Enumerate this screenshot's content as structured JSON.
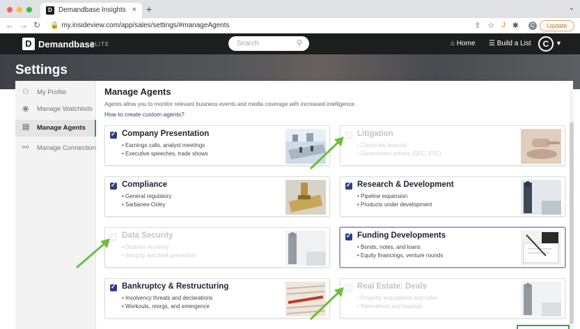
{
  "browser": {
    "tab_title": "Demandbase Insights",
    "tab_favicon": "D",
    "tab_close": "×",
    "new_tab": "+",
    "url": "my.insideview.com/app/sales/settings/#manageAgents",
    "update_label": "Update",
    "profile_initial": "C"
  },
  "header": {
    "logo_letter": "D",
    "brand": "Demandbase",
    "edition": "ELITE",
    "search_placeholder": "Search",
    "home_label": "Home",
    "build_list_label": "Build a List",
    "avatar_initial": "C"
  },
  "page": {
    "title": "Settings"
  },
  "sidebar": {
    "items": [
      {
        "label": "My Profile",
        "icon": "profile-icon"
      },
      {
        "label": "Manage Watchlists",
        "icon": "eye-icon"
      },
      {
        "label": "Manage Agents",
        "icon": "agents-icon",
        "active": true
      },
      {
        "label": "Manage Connections",
        "icon": "connections-icon"
      }
    ]
  },
  "main": {
    "title": "Manage Agents",
    "description": "Agents allow you to monitor relevant business events and media coverage with increased intelligence.",
    "help_link": "How to create custom agents?",
    "cards": [
      {
        "title": "Company Presentation",
        "bullets": [
          "• Earnings calls, analyst meetings",
          "• Executive speeches, trade shows"
        ],
        "checked": true,
        "image": "conference-room-image"
      },
      {
        "title": "Litigation",
        "bullets": [
          "• Corporate lawsuits",
          "• Government actions (SEC, FTC)"
        ],
        "checked": false,
        "image": "gavel-image"
      },
      {
        "title": "Compliance",
        "bullets": [
          "• General regulatory",
          "• Sarbanes-Oxley"
        ],
        "checked": true,
        "image": "compliance-stamp-image"
      },
      {
        "title": "Research & Development",
        "bullets": [
          "• Pipeline expansion",
          "• Products under development"
        ],
        "checked": true,
        "image": "business-person-image"
      },
      {
        "title": "Data Security",
        "bullets": [
          "• Disaster recovery",
          "• Integrity and theft prevention"
        ],
        "checked": false,
        "image": "business-person-image"
      },
      {
        "title": "Funding Developments",
        "bullets": [
          "• Bonds, notes, and loans",
          "• Equity financings, venture rounds"
        ],
        "checked": true,
        "image": "signing-document-image"
      },
      {
        "title": "Bankruptcy & Restructuring",
        "bullets": [
          "• Insolvency threats and declarations",
          "• Workouts, reorgs, and emergence"
        ],
        "checked": true,
        "image": "bankruptcy-text-image"
      },
      {
        "title": "Real Estate: Deals",
        "bullets": [
          "• Property acquisitions and sales",
          "• Relocations and leasings"
        ],
        "checked": false,
        "image": "business-person-image"
      }
    ]
  },
  "colors": {
    "accent_green": "#2c9c5c",
    "checkbox_blue": "#2f3d8c",
    "arrow_green": "#6cbf3c",
    "header_bg": "#1d1e20"
  }
}
